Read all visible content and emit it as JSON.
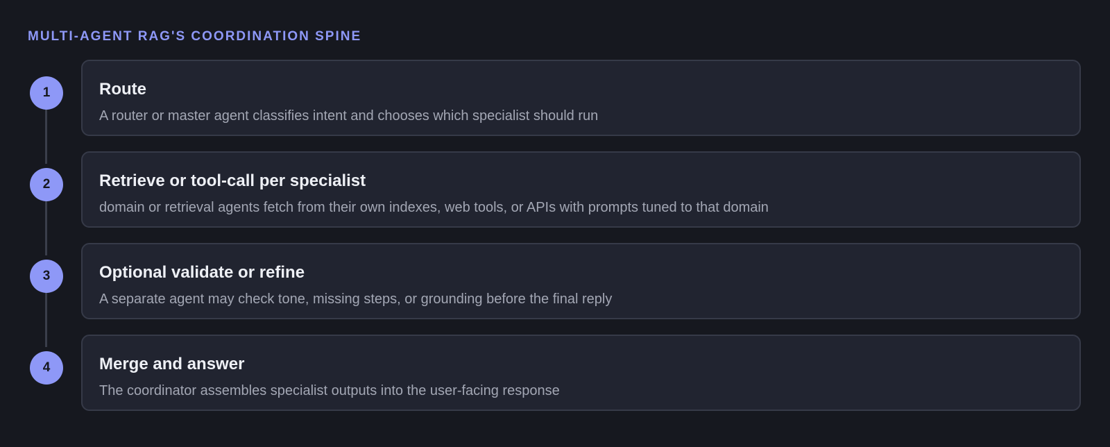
{
  "title": "MULTI-AGENT RAG'S COORDINATION SPINE",
  "steps": [
    {
      "number": "1",
      "title": "Route",
      "description": "A router or master agent classifies intent and chooses which specialist should run"
    },
    {
      "number": "2",
      "title": "Retrieve or tool-call per specialist",
      "description": "domain or retrieval agents fetch from their own indexes, web tools, or APIs with prompts tuned to that domain"
    },
    {
      "number": "3",
      "title": "Optional validate or refine",
      "description": "A separate agent may check tone, missing steps, or grounding before the final reply"
    },
    {
      "number": "4",
      "title": "Merge and answer",
      "description": "The coordinator assembles specialist outputs into the user-facing response"
    }
  ],
  "colors": {
    "background": "#16181f",
    "accent": "#8e98f7",
    "card": "#212430",
    "card_border": "#363a48",
    "connector": "#3a3e4b"
  }
}
